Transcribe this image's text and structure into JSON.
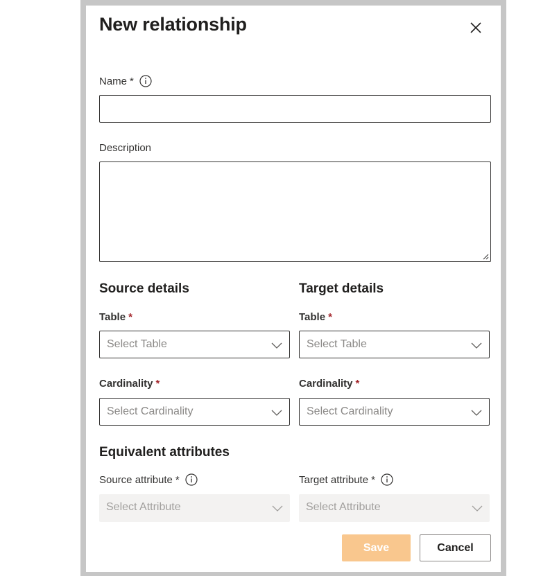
{
  "dialog": {
    "title": "New relationship"
  },
  "fields": {
    "name": {
      "label": "Name",
      "required_mark": "*",
      "value": ""
    },
    "description": {
      "label": "Description",
      "value": ""
    }
  },
  "source": {
    "heading": "Source details",
    "table": {
      "label": "Table",
      "required_mark": "*",
      "placeholder": "Select Table"
    },
    "cardinality": {
      "label": "Cardinality",
      "required_mark": "*",
      "placeholder": "Select Cardinality"
    }
  },
  "target": {
    "heading": "Target details",
    "table": {
      "label": "Table",
      "required_mark": "*",
      "placeholder": "Select Table"
    },
    "cardinality": {
      "label": "Cardinality",
      "required_mark": "*",
      "placeholder": "Select Cardinality"
    }
  },
  "equivalent": {
    "heading": "Equivalent attributes",
    "source_attribute": {
      "label": "Source attribute",
      "required_mark": "*",
      "placeholder": "Select Attribute"
    },
    "target_attribute": {
      "label": "Target attribute",
      "required_mark": "*",
      "placeholder": "Select Attribute"
    }
  },
  "actions": {
    "save_label": "Save",
    "cancel_label": "Cancel"
  },
  "colors": {
    "primary_disabled": "#f9c78e",
    "required_red": "#a4262c",
    "frame_gray": "#c6c6c6"
  }
}
